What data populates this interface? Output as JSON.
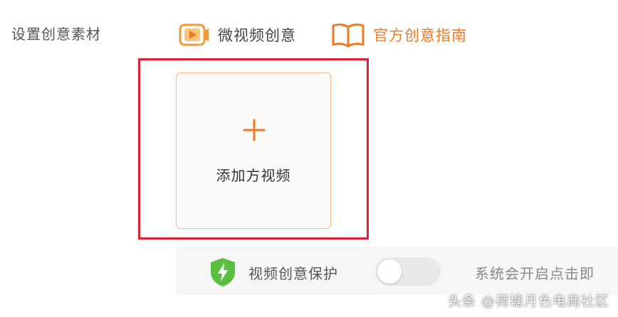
{
  "section": {
    "label": "设置创意素材"
  },
  "creative_type": {
    "icon": "video-play-icon",
    "label": "微视频创意"
  },
  "guide": {
    "icon": "open-book-icon",
    "label": "官方创意指南",
    "color": "#f07a24"
  },
  "upload": {
    "plus_icon": "plus-icon",
    "label": "添加方视频",
    "accent": "#f07a24"
  },
  "highlight": {
    "color": "#d9232e"
  },
  "protection": {
    "icon": "shield-bolt-icon",
    "label": "视频创意保护",
    "toggle_on": false,
    "hint": "系统会开启点击即"
  },
  "watermark": {
    "text": "头条 @荷塘月色电商社区"
  }
}
